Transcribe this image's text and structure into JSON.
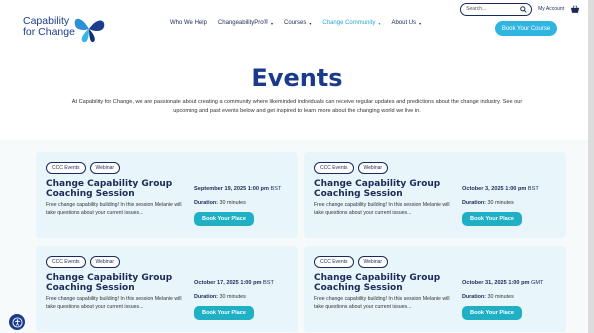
{
  "brand": {
    "line1": "Capability",
    "line2": "for Change"
  },
  "utility": {
    "search_placeholder": "Search...",
    "account_label": "My Account"
  },
  "nav": {
    "items": [
      {
        "label": "Who We Help",
        "caret": false
      },
      {
        "label": "ChangeabilityPro®",
        "caret": true
      },
      {
        "label": "Courses",
        "caret": true
      },
      {
        "label": "Change Community",
        "caret": true
      },
      {
        "label": "About Us",
        "caret": true
      }
    ],
    "caret_glyph": "▾",
    "cta_label": "Book Your Course"
  },
  "hero": {
    "title": "Events",
    "subtitle": "At Capability for Change, we are passionate about creating a community where likeminded individuals can receive regular updates and predictions about the change industry. See our upcoming and past events below and get inspired to learn more about the changing world we live in."
  },
  "events": [
    {
      "tags": [
        "CCC Events",
        "Webinar"
      ],
      "title": "Change Capability Group Coaching Session",
      "desc": "Free change capability building! In this session Melanie will take questions about your current issues...",
      "date": "September 19, 2025 1:00 pm",
      "tz": "BST",
      "duration_label": "Duration:",
      "duration": "30 minutes",
      "button": "Book Your Place"
    },
    {
      "tags": [
        "CCC Events",
        "Webinar"
      ],
      "title": "Change Capability Group Coaching Session",
      "desc": "Free change capability building! In this session Melanie will take questions about your current issues...",
      "date": "October 3, 2025 1:00 pm",
      "tz": "BST",
      "duration_label": "Duration:",
      "duration": "30 minutes",
      "button": "Book Your Place"
    },
    {
      "tags": [
        "CCC Events",
        "Webinar"
      ],
      "title": "Change Capability Group Coaching Session",
      "desc": "Free change capability building! In this session Melanie will take questions about your current issues...",
      "date": "October 17, 2025 1:00 pm",
      "tz": "BST",
      "duration_label": "Duration:",
      "duration": "30 minutes",
      "button": "Book Your Place"
    },
    {
      "tags": [
        "CCC Events",
        "Webinar"
      ],
      "title": "Change Capability Group Coaching Session",
      "desc": "Free change capability building! In this session Melanie will take questions about your current issues...",
      "date": "October 31, 2025 1:00 pm",
      "tz": "GMT",
      "duration_label": "Duration:",
      "duration": "30 minutes",
      "button": "Book Your Place"
    }
  ],
  "colors": {
    "navy": "#1a2b57",
    "brand_blue": "#1a3a8c",
    "accent_cyan": "#2fb6e0",
    "button_teal": "#1fb0c6",
    "card_bg": "#e8f5fa"
  },
  "icons": {
    "logo": "butterfly-icon",
    "search": "search-icon",
    "basket": "basket-icon",
    "accessibility": "accessibility-icon"
  }
}
